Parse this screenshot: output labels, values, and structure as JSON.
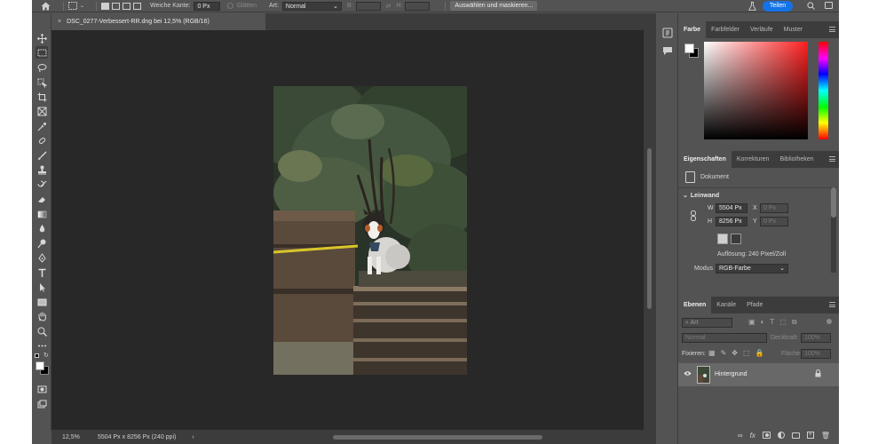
{
  "options_bar": {
    "feather_label": "Weiche Kante:",
    "feather_value": "0 Px",
    "smooth_label": "Glätten",
    "style_label": "Art:",
    "style_value": "Normal",
    "width_label": "B:",
    "height_label": "H:",
    "select_mask_button": "Auswählen und maskieren...",
    "share_button": "Teilen"
  },
  "document": {
    "tab_title": "DSC_0277-Verbessert-RR.dng bei 12,5% (RGB/16)",
    "tab_close": "×"
  },
  "status": {
    "zoom": "12,5%",
    "info": "5504 Px x 8256 Px (240 ppi)",
    "arrow": "›"
  },
  "color_panel": {
    "tabs": [
      "Farbe",
      "Farbfelder",
      "Verläufe",
      "Muster"
    ],
    "foreground": "#ffffff",
    "background": "#000000"
  },
  "properties_panel": {
    "tabs": [
      "Eigenschaften",
      "Korrekturen",
      "Bibliotheken"
    ],
    "doc_label": "Dokument",
    "section_canvas": "Leinwand",
    "w_label": "W",
    "w_value": "5504 Px",
    "x_label": "X",
    "x_value": "0 Px",
    "h_label": "H",
    "h_value": "8256 Px",
    "y_label": "Y",
    "y_value": "0 Px",
    "resolution": "Auflösung: 240 Pixel/Zoll",
    "mode_label": "Modus",
    "mode_value": "RGB-Farbe"
  },
  "layers_panel": {
    "tabs": [
      "Ebenen",
      "Kanäle",
      "Pfade"
    ],
    "search_placeholder": "Art",
    "blend_mode": "Normal",
    "opacity_label": "Deckkraft:",
    "opacity_value": "100%",
    "lock_label": "Fixieren:",
    "fill_label": "Fläche:",
    "fill_value": "100%",
    "layer_name": "Hintergrund",
    "bottom_icons": [
      "∞",
      "fx"
    ]
  },
  "colors": {
    "accent": "#1473e6",
    "panel_bg": "#535353",
    "canvas_bg": "#282828"
  }
}
